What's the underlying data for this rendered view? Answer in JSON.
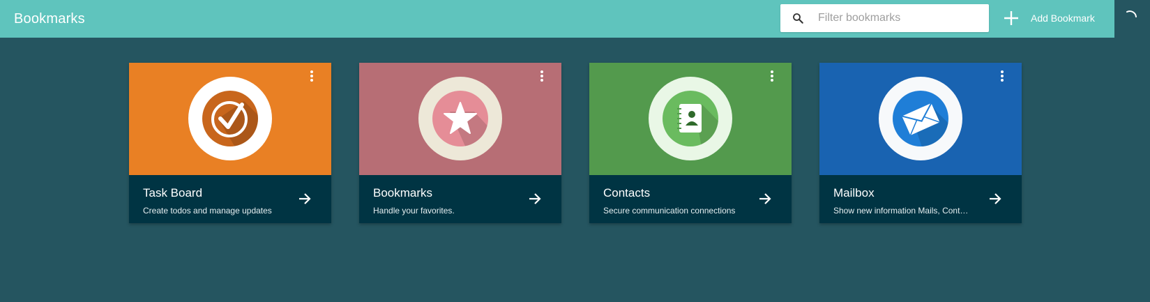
{
  "header": {
    "title": "Bookmarks",
    "search_placeholder": "Filter bookmarks",
    "search_value": "",
    "add_label": "Add Bookmark"
  },
  "colors": {
    "background": "#255560",
    "header": "#5fc4bd",
    "card_footer": "#003443"
  },
  "cards": [
    {
      "title": "Task Board",
      "subtitle": "Create todos and manage updates",
      "color": "#e98024",
      "ring": "#ffffff",
      "inner": "#c8661c",
      "icon": "checkmark-icon"
    },
    {
      "title": "Bookmarks",
      "subtitle": "Handle your favorites.",
      "color": "#b76e75",
      "ring": "#ede8d8",
      "inner": "#e58d97",
      "icon": "star-icon"
    },
    {
      "title": "Contacts",
      "subtitle": "Secure communication connections",
      "color": "#539a4d",
      "ring": "#e9f7e6",
      "inner": "#6abb5f",
      "icon": "address-book-icon"
    },
    {
      "title": "Mailbox",
      "subtitle": "Show new information Mails, Contacts",
      "color": "#1963b1",
      "ring": "#f7f9fb",
      "inner": "#1f7ed7",
      "icon": "envelope-icon"
    }
  ]
}
